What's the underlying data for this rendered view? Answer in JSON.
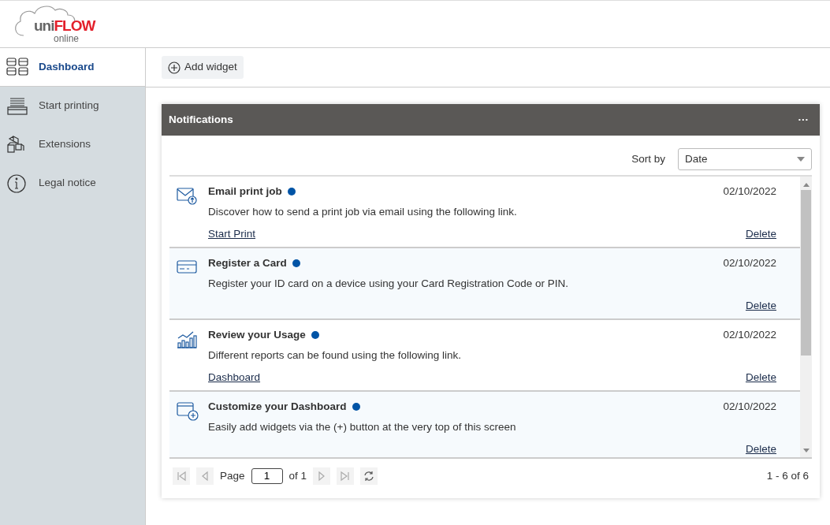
{
  "logo": {
    "prefix": "uni",
    "brand": "FLOW",
    "suffix": "online"
  },
  "sidebar": {
    "items": [
      {
        "label": "Dashboard",
        "selected": true,
        "kind": "grid"
      },
      {
        "label": "Start printing",
        "selected": false,
        "kind": "tray"
      },
      {
        "label": "Extensions",
        "selected": false,
        "kind": "cubes"
      },
      {
        "label": "Legal notice",
        "selected": false,
        "kind": "info"
      }
    ]
  },
  "toolbar": {
    "add_button": "Add widget"
  },
  "widget": {
    "title": "Notifications",
    "menu": "···",
    "sort": {
      "label": "Sort by",
      "value": "Date"
    },
    "notifications": [
      {
        "kind": "email",
        "title": "Email print job",
        "unread": true,
        "date": "02/10/2022",
        "text": "Discover how to send a print job via email using the following link.",
        "link": "Start Print",
        "delete": "Delete"
      },
      {
        "kind": "card",
        "title": "Register a Card",
        "unread": true,
        "date": "02/10/2022",
        "text": "Register your ID card on a device using your Card Registration Code or PIN.",
        "delete": "Delete"
      },
      {
        "kind": "chart",
        "title": "Review your Usage",
        "unread": true,
        "date": "02/10/2022",
        "text": "Different reports can be found using the following link.",
        "link": "Dashboard",
        "delete": "Delete"
      },
      {
        "kind": "window",
        "title": "Customize your Dashboard",
        "unread": true,
        "date": "02/10/2022",
        "text": "Easily add widgets via the (+) button at the very top of this screen",
        "delete": "Delete"
      }
    ],
    "pager": {
      "page_label": "Page",
      "page": "1",
      "of": "of 1",
      "summary": "1 - 6 of 6"
    }
  }
}
